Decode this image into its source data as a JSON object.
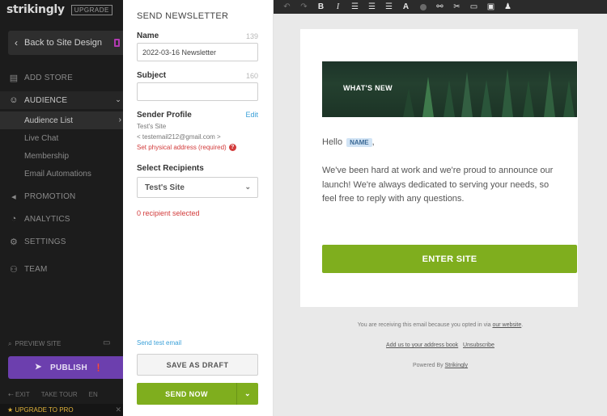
{
  "sidebar": {
    "logo": "strikingly",
    "upgrade_badge": "UPGRADE",
    "back_label": "Back to Site Design",
    "add_store": "ADD STORE",
    "audience": "AUDIENCE",
    "sub_items": [
      "Audience List",
      "Live Chat",
      "Membership",
      "Email Automations"
    ],
    "promotion": "PROMOTION",
    "analytics": "ANALYTICS",
    "settings": "SETTINGS",
    "team": "TEAM",
    "preview_site": "PREVIEW SITE",
    "publish": "PUBLISH",
    "bottom_links": [
      "EXIT",
      "TAKE TOUR",
      "EN"
    ],
    "upgrade_pro": "UPGRADE TO PRO"
  },
  "panel": {
    "title": "SEND NEWSLETTER",
    "name_label": "Name",
    "name_count": "139",
    "name_value": "2022-03-16 Newsletter",
    "subject_label": "Subject",
    "subject_count": "160",
    "subject_value": "",
    "sender_label": "Sender Profile",
    "edit_label": "Edit",
    "sender_name": "Test's Site",
    "sender_email": "< testemail212@gmail.com >",
    "sender_warning": "Set physical address (required)",
    "recipients_label": "Select Recipients",
    "recipients_value": "Test's Site",
    "recipient_count": "0 recipient selected",
    "send_test": "Send test email",
    "save_draft": "SAVE AS DRAFT",
    "send_now": "SEND NOW"
  },
  "email": {
    "banner_title": "WHAT'S NEW",
    "hello": "Hello",
    "name_tag": "NAME",
    "comma": ",",
    "body": "We've been hard at work and we're proud to announce our launch! We're always dedicated to serving your needs, so feel free to reply with any questions.",
    "cta": "ENTER SITE"
  },
  "footer": {
    "line1_text": "You are receiving this email because you opted in via",
    "line1_link": "our website",
    "line1_end": ".",
    "address_link": "Add us to your address book",
    "unsubscribe": "Unsubscribe",
    "powered_text": "Powered By",
    "powered_link": "Strikingly"
  },
  "colors": {
    "accent_green": "#7fae1e",
    "publish_purple": "#6c3fae",
    "error_red": "#d23b3b",
    "link_blue": "#3aa0d8"
  }
}
